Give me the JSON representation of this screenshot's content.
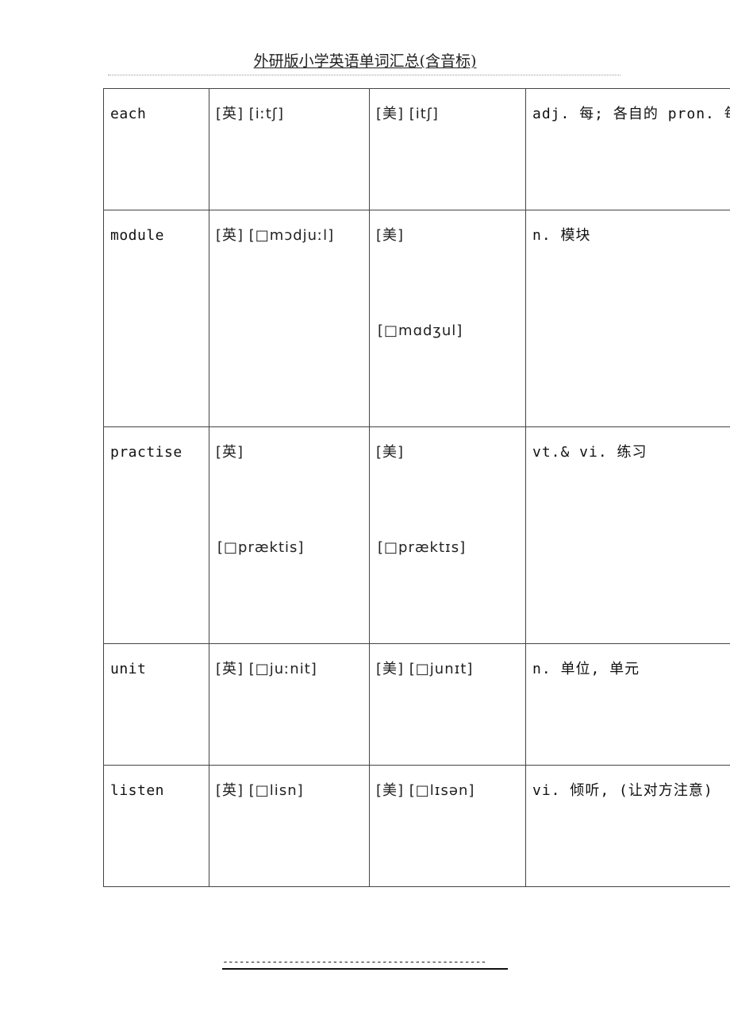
{
  "document": {
    "title": "外研版小学英语单词汇总(含音标)",
    "footer": "------------------------------------------------"
  },
  "table": {
    "rows": [
      {
        "word": "each",
        "uk_label": "[英]",
        "uk_phonetic": "[iːtʃ]",
        "uk_inline": true,
        "us_label": "[美]",
        "us_phonetic": "[itʃ]",
        "us_inline": true,
        "definition": "adj. 每;  各自的 pron. 每个"
      },
      {
        "word": "module",
        "uk_label": "[英]",
        "uk_phonetic": "[□mɔdjuːl]",
        "uk_inline": true,
        "us_label": "[美]",
        "us_phonetic": "[□mɑdʒul]",
        "us_inline": false,
        "definition": "n.  模块"
      },
      {
        "word": "practise",
        "uk_label": "[英]",
        "uk_phonetic": "[□præktis]",
        "uk_inline": false,
        "us_label": "[美]",
        "us_phonetic": "[□præktɪs]",
        "us_inline": false,
        "definition": "vt.& vi.  练习"
      },
      {
        "word": "unit",
        "uk_label": "[英]",
        "uk_phonetic": "[□juːnit]",
        "uk_inline": true,
        "us_label": "[美]",
        "us_phonetic": "[□junɪt]",
        "us_inline": true,
        "definition": "n.  单位, 单元"
      },
      {
        "word": "listen",
        "uk_label": "[英]",
        "uk_phonetic": "[□lisn]",
        "uk_inline": true,
        "us_label": "[美]",
        "us_phonetic": "[□lɪsən]",
        "us_inline": true,
        "definition": "vi.  倾听, (让对方注意)"
      }
    ]
  }
}
